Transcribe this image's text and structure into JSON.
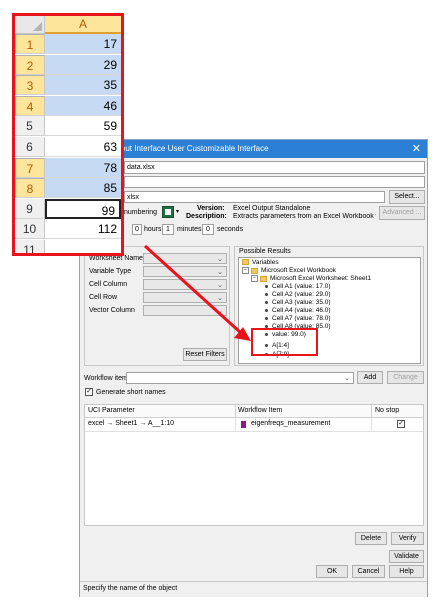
{
  "dialog": {
    "title": "Output Interface User Customizable Interface",
    "close_glyph": "✕",
    "file_field": "data.xlsx",
    "file_field2": "xlsx",
    "select_button": "Select...",
    "numbering_label": "numbering",
    "version_label": "Version:",
    "version_value": "Excel Output Standalone",
    "description_label": "Description:",
    "description_value": "Extracts parameters from an Excel Workbook witho",
    "advanced_button": "Advanced ...",
    "time": {
      "hours_value": "0",
      "hours_label": "hours",
      "minutes_value": "1",
      "minutes_label": "minutes",
      "seconds_value": "0",
      "seconds_label": "seconds"
    },
    "filters": [
      {
        "label": "Worksheet Name"
      },
      {
        "label": "Variable Type"
      },
      {
        "label": "Cell Column"
      },
      {
        "label": "Cell Row"
      },
      {
        "label": "Vector Column"
      }
    ],
    "reset_filters_button": "Reset Filters",
    "possible_results": {
      "header": "Possible Results",
      "root": "Variables",
      "workbook": "Microsoft Excel Workbook",
      "worksheet": "Microsoft Excel Worksheet: Sheet1",
      "cells": [
        "Cell A1 (value: 17.0)",
        "Cell A2 (value: 29.0)",
        "Cell A3 (value: 35.0)",
        "Cell A4 (value: 46.0)",
        "Cell A7 (value: 78.0)",
        "Cell A8 (value: 85.0)",
        "value: 99.0)"
      ],
      "ranges": [
        "A[1:4]",
        "A[7:9]"
      ]
    },
    "workflow_item_label": "Workflow item",
    "add_button": "Add",
    "change_button": "Change",
    "generate_short_names": "Generate short names",
    "table": {
      "headers": [
        "UCI Parameter",
        "Workflow Item",
        "No stop"
      ],
      "rows": [
        {
          "parameter": "excel → Sheet1 → A__1:10",
          "workflow_item": "eigenfreqs_measurement",
          "no_stop": true
        }
      ]
    },
    "delete_button": "Delete",
    "verify_button": "Verify",
    "validate_button": "Validate",
    "ok_button": "OK",
    "cancel_button": "Cancel",
    "help_button": "Help",
    "status_text": "Specify the name of the object"
  },
  "excel": {
    "column_header": "A",
    "rows": [
      {
        "num": "1",
        "value": "17",
        "highlighted": true
      },
      {
        "num": "2",
        "value": "29",
        "highlighted": true
      },
      {
        "num": "3",
        "value": "35",
        "highlighted": true
      },
      {
        "num": "4",
        "value": "46",
        "highlighted": true
      },
      {
        "num": "5",
        "value": "59",
        "highlighted": false
      },
      {
        "num": "6",
        "value": "63",
        "highlighted": false
      },
      {
        "num": "7",
        "value": "78",
        "highlighted": true
      },
      {
        "num": "8",
        "value": "85",
        "highlighted": true
      },
      {
        "num": "9",
        "value": "99",
        "highlighted": false
      },
      {
        "num": "10",
        "value": "112",
        "highlighted": false
      },
      {
        "num": "11",
        "value": "",
        "highlighted": false
      }
    ]
  },
  "colors": {
    "title_bar": "#2b7fd4",
    "annotation_red": "#e8141c",
    "cell_highlight": "#c6dbf3"
  }
}
